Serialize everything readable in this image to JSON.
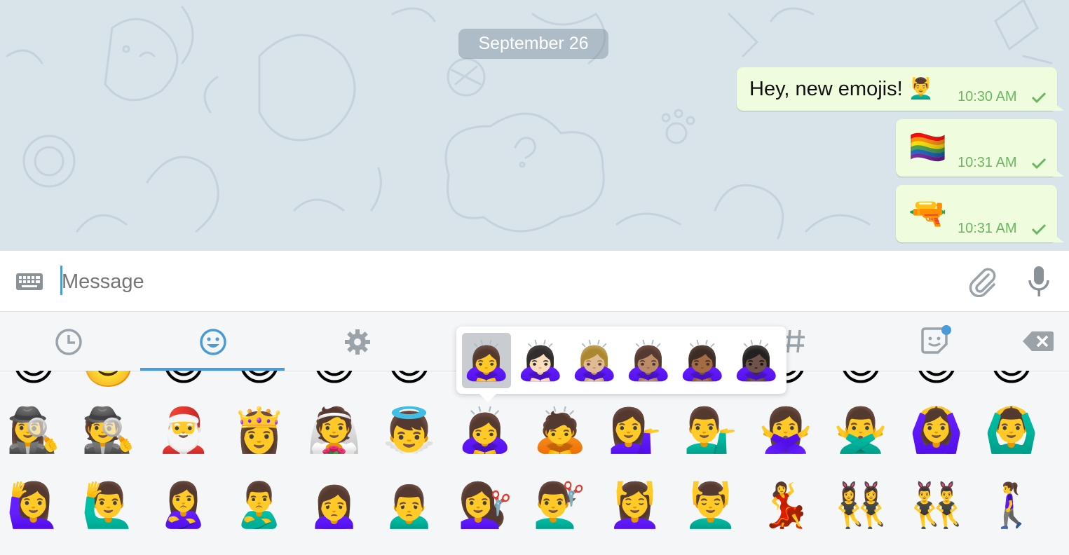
{
  "chat": {
    "date": "September 26",
    "messages": [
      {
        "text": "Hey, new emojis! 💆‍♂️",
        "time": "10:30 AM"
      },
      {
        "text": "🏳️‍🌈",
        "time": "10:31 AM"
      },
      {
        "text": "🔫",
        "time": "10:31 AM"
      }
    ]
  },
  "input": {
    "placeholder": "Message"
  },
  "icons": {
    "keyboard": "keyboard-icon",
    "attach": "paperclip-icon",
    "mic": "microphone-icon",
    "tabs": [
      "clock-icon",
      "smiley-icon",
      "gear-icon",
      "hash-icon",
      "sticker-icon",
      "backspace-icon"
    ]
  },
  "colors": {
    "accent": "#4a9bd9",
    "bubble": "#effdde",
    "time": "#6cb561",
    "chat_bg": "#d9e3ea"
  },
  "emoji_rows": {
    "partial": [
      "😊",
      "🙂",
      "😊",
      "😊",
      "😊",
      "😊",
      "😊",
      "😊",
      "😊",
      "😊",
      "😊",
      "😊",
      "😊",
      "😊"
    ],
    "row1": [
      "🕵️‍♀️",
      "🕵️",
      "🎅",
      "👸",
      "👰",
      "👼",
      "🙇‍♀️",
      "🙇",
      "💁‍♀️",
      "💁‍♂️",
      "🙅‍♀️",
      "🙅‍♂️",
      "🙆‍♀️",
      "🙆‍♂️"
    ],
    "row2": [
      "🙋‍♀️",
      "🙋‍♂️",
      "🙎‍♀️",
      "🙎‍♂️",
      "🙍‍♀️",
      "🙍‍♂️",
      "💇‍♀️",
      "💇‍♂️",
      "💆‍♀️",
      "💆‍♂️",
      "💃",
      "👯‍♀️",
      "👯‍♂️",
      "🚶‍♀️"
    ]
  },
  "skin_popup": {
    "options": [
      "🙇‍♀️",
      "🙇🏻‍♀️",
      "🙇🏼‍♀️",
      "🙇🏽‍♀️",
      "🙇🏾‍♀️",
      "🙇🏿‍♀️"
    ],
    "selected_index": 0
  }
}
